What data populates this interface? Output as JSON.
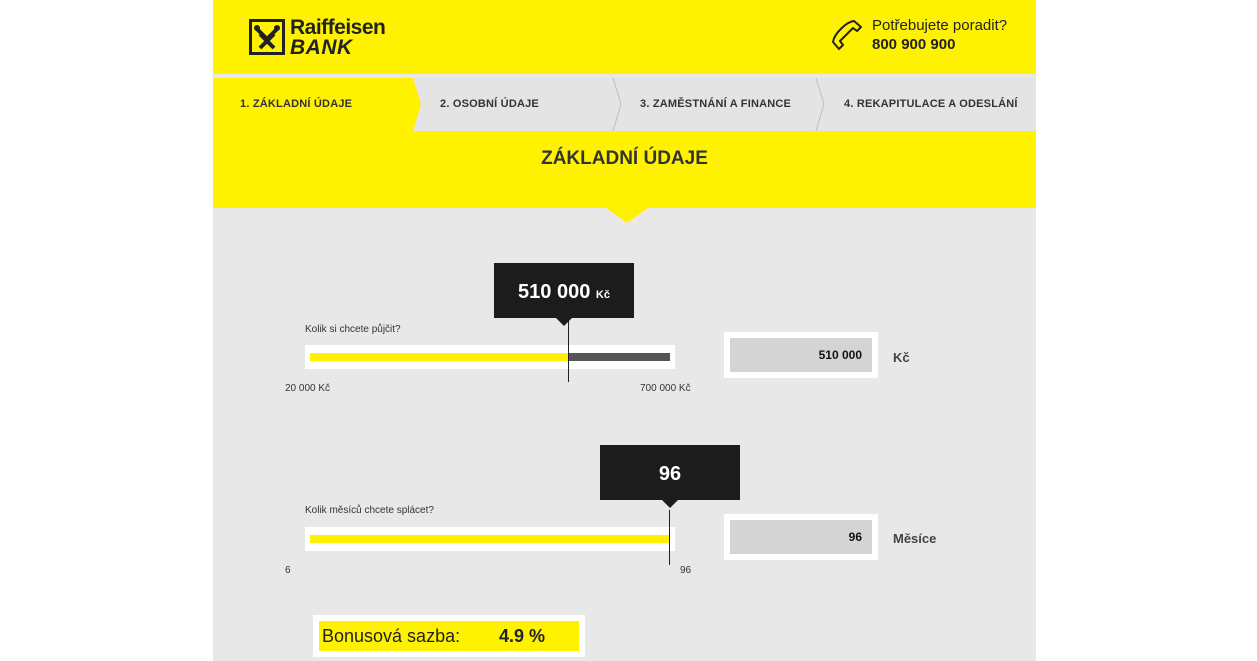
{
  "brand": {
    "name_line1": "Raiffeisen",
    "name_line2": "BANK",
    "accent": "#fff200"
  },
  "help": {
    "text": "Potřebujete poradit?",
    "phone": "800 900 900",
    "icon": "phone-icon"
  },
  "steps": [
    {
      "label": "1. ZÁKLADNÍ ÚDAJE",
      "active": true
    },
    {
      "label": "2. OSOBNÍ ÚDAJE",
      "active": false
    },
    {
      "label": "3. ZAMĚSTNÁNÍ A FINANCE",
      "active": false
    },
    {
      "label": "4. REKAPITULACE A ODESLÁNÍ",
      "active": false
    }
  ],
  "section_title": "ZÁKLADNÍ ÚDAJE",
  "loan": {
    "bubble_value": "510 000",
    "bubble_unit": "Kč",
    "question": "Kolik si chcete půjčit?",
    "min_label": "20 000 Kč",
    "max_label": "700 000 Kč",
    "min": 20000,
    "max": 700000,
    "value": 510000,
    "input_value": "510 000",
    "unit": "Kč"
  },
  "months": {
    "bubble_value": "96",
    "question": "Kolik měsíců chcete splácet?",
    "min_label": "6",
    "max_label": "96",
    "min": 6,
    "max": 96,
    "value": 96,
    "input_value": "96",
    "unit": "Měsíce"
  },
  "bonus": {
    "label": "Bonusová sazba:",
    "value": "4.9 %"
  }
}
